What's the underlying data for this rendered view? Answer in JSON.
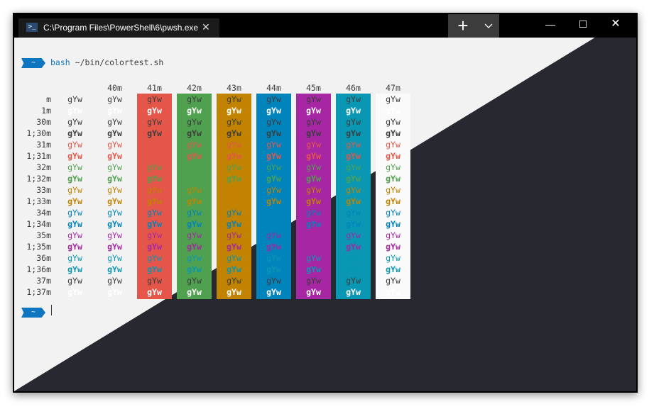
{
  "window": {
    "tab": {
      "icon": "powershell-icon",
      "title": "C:\\Program Files\\PowerShell\\6\\pwsh.exe",
      "close_glyph": "✕"
    },
    "new_tab_glyph": "+",
    "dropdown_glyph": "⌄",
    "controls": {
      "minimize": "—",
      "maximize": "☐",
      "close": "✕"
    }
  },
  "terminal": {
    "prompt_symbol": "~",
    "command": {
      "name": "bash",
      "args": "~/bin/colortest.sh"
    },
    "sample_text": "gYw",
    "row_labels": [
      "m",
      "1m",
      "30m",
      "1;30m",
      "31m",
      "1;31m",
      "32m",
      "1;32m",
      "33m",
      "1;33m",
      "34m",
      "1;34m",
      "35m",
      "1;35m",
      "36m",
      "1;36m",
      "37m",
      "1;37m"
    ],
    "column_headers": [
      "",
      "40m",
      "41m",
      "42m",
      "43m",
      "44m",
      "45m",
      "46m",
      "47m"
    ],
    "colors": {
      "background_light": "#f2f2f2",
      "background_dark": "#272830",
      "prompt_accent": "#0e75c0",
      "fg": {
        "default": "#3c3c3c",
        "bold_default": "#ffffff",
        "black": "#3c3c3c",
        "red": "#e45649",
        "green": "#50a14f",
        "yellow": "#c18301",
        "blue": "#0184bc",
        "magenta": "#a626a4",
        "cyan": "#0997b3",
        "white": "#3c3c3c",
        "bold_white": "#ffffff"
      },
      "bg": {
        "40m": "transparent",
        "41m": "#e45649",
        "42m": "#50a14f",
        "43m": "#c18301",
        "44m": "#0184bc",
        "45m": "#a626a4",
        "46m": "#0997b3",
        "47m": "#fafafa"
      }
    }
  }
}
